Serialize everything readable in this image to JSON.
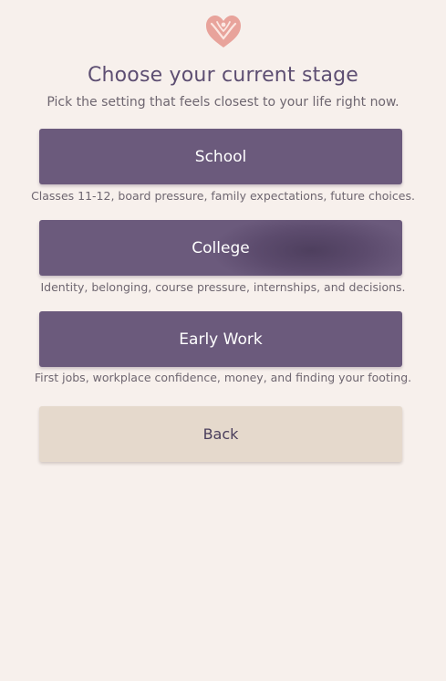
{
  "header": {
    "logo_icon": "heart-hands-icon",
    "title": "Choose your current stage",
    "subtitle": "Pick the setting that feels closest to your life right now."
  },
  "stages": [
    {
      "label": "School",
      "description": "Classes 11-12, board pressure, family expectations, future choices."
    },
    {
      "label": "College",
      "description": "Identity, belonging, course pressure, internships, and decisions."
    },
    {
      "label": "Early Work",
      "description": "First jobs, workplace confidence, money, and finding your footing."
    }
  ],
  "back_label": "Back",
  "colors": {
    "background": "#f7f0ec",
    "primary_button": "#6b5a7c",
    "secondary_button": "#e5d9cc",
    "title_text": "#5d4e72",
    "logo": "#d98a84"
  }
}
